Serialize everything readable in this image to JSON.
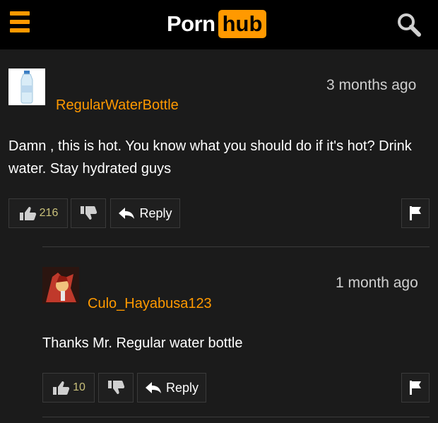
{
  "header": {
    "logo_left": "Porn",
    "logo_right": "hub",
    "hamburger_icon": "hamburger-icon",
    "search_icon": "search-icon",
    "colors": {
      "background": "#000000",
      "accent": "#ff9900"
    }
  },
  "comments": [
    {
      "username": "RegularWaterBottle",
      "timestamp": "3 months ago",
      "text": "Damn , this is hot. You know what you should do if it's hot? Drink water. Stay hydrated guys",
      "likes": "216",
      "reply_label": "Reply"
    },
    {
      "username": "Culo_Hayabusa123",
      "timestamp": "1 month ago",
      "text": "Thanks Mr. Regular water bottle",
      "likes": "10",
      "reply_label": "Reply"
    }
  ],
  "colors": {
    "page_background": "#1b1b1b",
    "username": "#ff9900",
    "vote_count": "#c9c07a"
  }
}
